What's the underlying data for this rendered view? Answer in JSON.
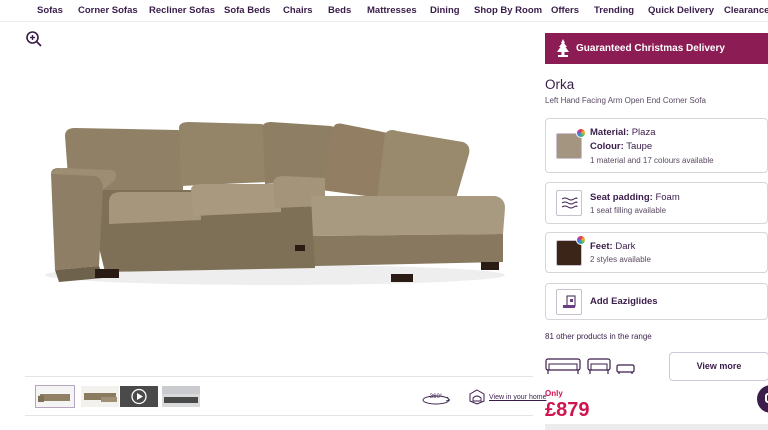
{
  "nav": {
    "items": [
      "Sofas",
      "Corner Sofas",
      "Recliner Sofas",
      "Sofa Beds",
      "Chairs",
      "Beds",
      "Mattresses",
      "Dining",
      "Shop By Room",
      "Offers",
      "Trending",
      "Quick Delivery",
      "Clearance"
    ]
  },
  "gallery": {
    "zoom_icon": "magnifier-plus-icon",
    "view_360_label": "360°",
    "view_in_home_label": "View in your home"
  },
  "promo": {
    "label": "Guaranteed Christmas Delivery",
    "icon": "christmas-tree-icon",
    "color": "#8b1d54"
  },
  "product": {
    "title": "Orka",
    "subtitle": "Left Hand Facing Arm Open End Corner Sofa"
  },
  "options": {
    "material": {
      "key": "Material:",
      "value": "Plaza",
      "sub_key": "Colour:",
      "sub_value": "Taupe",
      "note": "1 material and 17 colours available",
      "swatch_color": "#a39580"
    },
    "padding": {
      "key": "Seat padding:",
      "value": "Foam",
      "note": "1 seat filling available",
      "icon": "wave-lines-icon"
    },
    "feet": {
      "key": "Feet:",
      "value": "Dark",
      "note": "2 styles available",
      "swatch_color": "#3b2418"
    },
    "glides": {
      "label": "Add Eaziglides",
      "icon": "glides-icon"
    }
  },
  "range": {
    "text": "81 other products in the range",
    "button": "View more"
  },
  "price": {
    "only": "Only",
    "value": "£879",
    "color": "#d1134f"
  }
}
